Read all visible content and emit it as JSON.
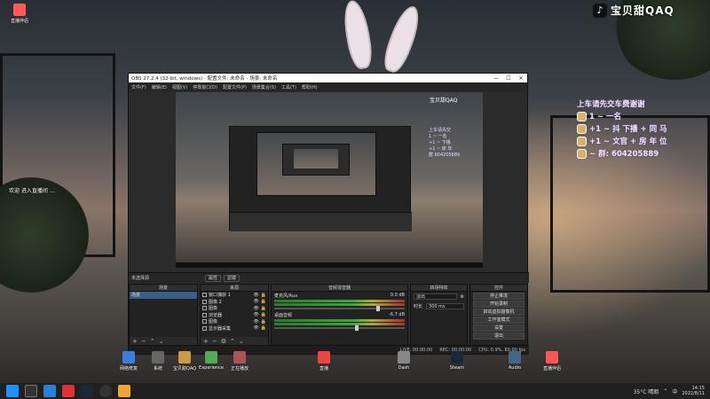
{
  "desktop": {
    "top_left_icon": {
      "label": "直播伴侣"
    },
    "side_text": "欢迎 进入直播间  …",
    "badge": {
      "logo": "♪",
      "name": "宝贝甜QAQ"
    },
    "chat_lines": [
      "上车请先交车费谢谢",
      "1 ~ 一名",
      "+1 ~ 抖 下播 + 同 马",
      "+1 ~ 文官 + 房 年 位",
      "~ 群: 604205889"
    ],
    "bottom_icons": [
      "网络修复",
      "系统",
      "宝贝甜QAQ",
      "Experience",
      "正在播放",
      "",
      "",
      "",
      "",
      "直播",
      "",
      "",
      "",
      "",
      "Steam",
      "",
      "",
      "",
      "",
      "",
      "",
      "Dash",
      "",
      "",
      "",
      "",
      "Audio",
      "",
      "",
      "",
      "直播伴侣"
    ]
  },
  "obs": {
    "title": "OBS 27.2.4 (32-bit, windows) - 配置文件: 未命名 - 场景: 未命名",
    "menu": [
      "文件(F)",
      "编辑(E)",
      "视图(V)",
      "停靠窗口(D)",
      "配置文件(P)",
      "场景集合(S)",
      "工具(T)",
      "帮助(H)"
    ],
    "preview_logo": "宝贝甜QAQ",
    "preview_chat": [
      "上车请先交",
      "1 ~ 一名",
      "+1 ~ 下播",
      "+1 ~ 房 年",
      "群 604205889"
    ],
    "dock_label": "未选择源",
    "dock_buttons": [
      "属性",
      "滤镜"
    ],
    "scenes": {
      "header": "场景",
      "items": [
        "场景"
      ]
    },
    "sources": {
      "header": "来源",
      "items": [
        "窗口捕获 1",
        "图像 2",
        "图像",
        "浏览器",
        "图像",
        "显示器采集"
      ]
    },
    "mixer": {
      "header": "音频混音器",
      "tracks": [
        {
          "name": "麦克风/Aux",
          "db": "0.0 dB",
          "level": 0.78
        },
        {
          "name": "桌面音频",
          "db": "-6.7 dB",
          "level": 0.62
        }
      ]
    },
    "transitions": {
      "header": "转场特效",
      "type": "淡出",
      "duration_label": "时长",
      "duration": "300 ms"
    },
    "controls": {
      "header": "控件",
      "buttons": [
        "停止推流",
        "开始录制",
        "启动虚拟摄像机",
        "工作室模式",
        "设置",
        "退出"
      ]
    },
    "status": [
      "LIVE: 00:00:00",
      "REC: 00:00:00",
      "CPU: 0.9%, 60.00 fps"
    ]
  },
  "taskbar": {
    "weather": "35°C 晴朗",
    "ime": "中",
    "time": "14:15",
    "date": "2022/8/11"
  }
}
